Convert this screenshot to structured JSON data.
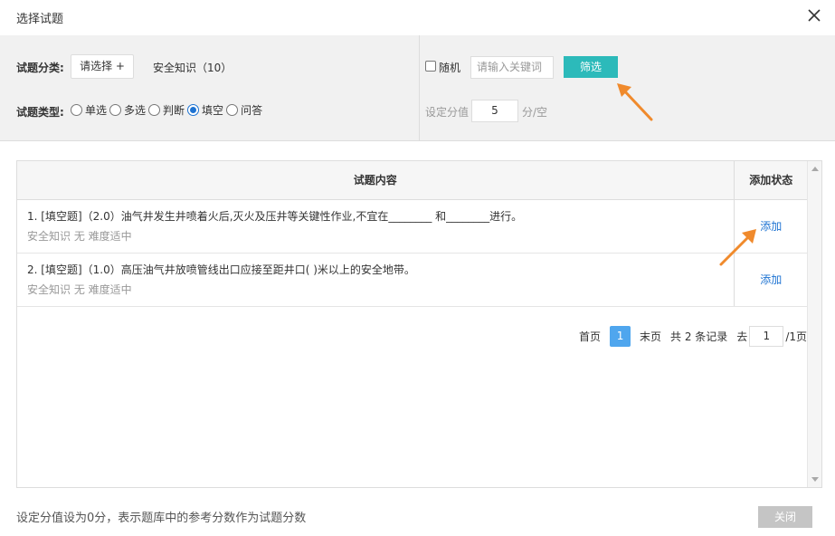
{
  "dialog": {
    "title": "选择试题"
  },
  "filter": {
    "category_label": "试题分类:",
    "choose_button": "请选择 +",
    "category_selected": "安全知识（10）",
    "type_label": "试题类型:",
    "types": [
      {
        "label": "单选",
        "checked": false
      },
      {
        "label": "多选",
        "checked": false
      },
      {
        "label": "判断",
        "checked": false
      },
      {
        "label": "填空",
        "checked": true
      },
      {
        "label": "问答",
        "checked": false
      }
    ],
    "random_label": "随机",
    "random_checked": false,
    "keyword_placeholder": "请输入关键词",
    "filter_button": "筛选",
    "score_label": "设定分值",
    "score_value": "5",
    "score_unit": "分/空"
  },
  "table": {
    "headers": {
      "content": "试题内容",
      "status": "添加状态"
    },
    "rows": [
      {
        "question": "1. [填空题]（2.0）油气井发生井喷着火后,灭火及压井等关键性作业,不宜在________ 和________进行。",
        "meta": "安全知识  无  难度适中",
        "action": "添加"
      },
      {
        "question": "2. [填空题]（1.0）高压油气井放喷管线出口应接至距井口( )米以上的安全地带。",
        "meta": "安全知识  无  难度适中",
        "action": "添加"
      }
    ]
  },
  "pagination": {
    "first": "首页",
    "current": "1",
    "last": "末页",
    "total": "共 2 条记录",
    "goto": "去",
    "goto_value": "1",
    "pages": "/1页"
  },
  "footer": {
    "note": "设定分值设为0分，表示题库中的参考分数作为试题分数",
    "close_button": "关闭"
  },
  "colors": {
    "accent_teal": "#2cbaba",
    "link_blue": "#1e73d2",
    "page_blue": "#4fa6ee",
    "annotation_orange": "#f08a2c"
  }
}
